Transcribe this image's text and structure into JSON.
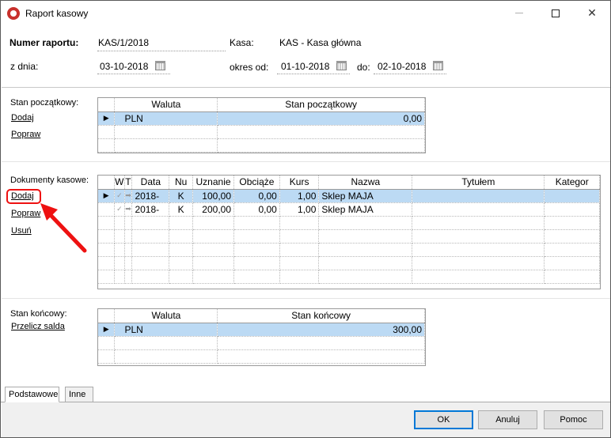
{
  "window": {
    "title": "Raport kasowy",
    "controls": {
      "minimize": "–",
      "maximize": "□",
      "close": "✕"
    }
  },
  "header": {
    "report_number_label": "Numer raportu:",
    "report_number_value": "KAS/1/2018",
    "kasa_label": "Kasa:",
    "kasa_value": "KAS - Kasa główna",
    "date_label": "z dnia:",
    "date_value": "03-10-2018",
    "period_from_label": "okres od:",
    "period_from_value": "01-10-2018",
    "period_to_label": "do:",
    "period_to_value": "02-10-2018"
  },
  "opening": {
    "label": "Stan początkowy:",
    "links": {
      "add": "Dodaj",
      "edit": "Popraw"
    },
    "columns": [
      "Waluta",
      "Stan początkowy"
    ],
    "rows": [
      {
        "currency": "PLN",
        "amount": "0,00"
      }
    ]
  },
  "documents": {
    "label": "Dokumenty kasowe:",
    "links": {
      "add": "Dodaj",
      "edit": "Popraw",
      "delete": "Usuń"
    },
    "columns": [
      "W",
      "T",
      "Data",
      "Nu",
      "Uznanie",
      "Obciąże",
      "Kurs",
      "Nazwa",
      "Tytułem",
      "Kategor"
    ],
    "rows": [
      {
        "data": "2018-",
        "nu": "K",
        "uznanie": "100,00",
        "obciazenie": "0,00",
        "kurs": "1,00",
        "nazwa": "Sklep MAJA",
        "tytulem": "",
        "kategoria": ""
      },
      {
        "data": "2018-",
        "nu": "K",
        "uznanie": "200,00",
        "obciazenie": "0,00",
        "kurs": "1,00",
        "nazwa": "Sklep MAJA",
        "tytulem": "",
        "kategoria": ""
      }
    ]
  },
  "closing": {
    "label": "Stan końcowy:",
    "links": {
      "recalc": "Przelicz salda"
    },
    "columns": [
      "Waluta",
      "Stan końcowy"
    ],
    "rows": [
      {
        "currency": "PLN",
        "amount": "300,00"
      }
    ]
  },
  "tabs": [
    {
      "label": "Podstawowe",
      "active": true
    },
    {
      "label": "Inne",
      "active": false
    }
  ],
  "buttons": {
    "ok": "OK",
    "cancel": "Anuluj",
    "help": "Pomoc"
  },
  "colors": {
    "selection": "#bcdaf4",
    "annotation": "#e11111",
    "default_button_border": "#0078d7"
  },
  "icons": {
    "app": "app-logo-icon",
    "calendar": "calendar-icon",
    "row_pointer": "triangle-right-icon",
    "checkmark": "check-icon",
    "arrow": "arrow-icon"
  }
}
